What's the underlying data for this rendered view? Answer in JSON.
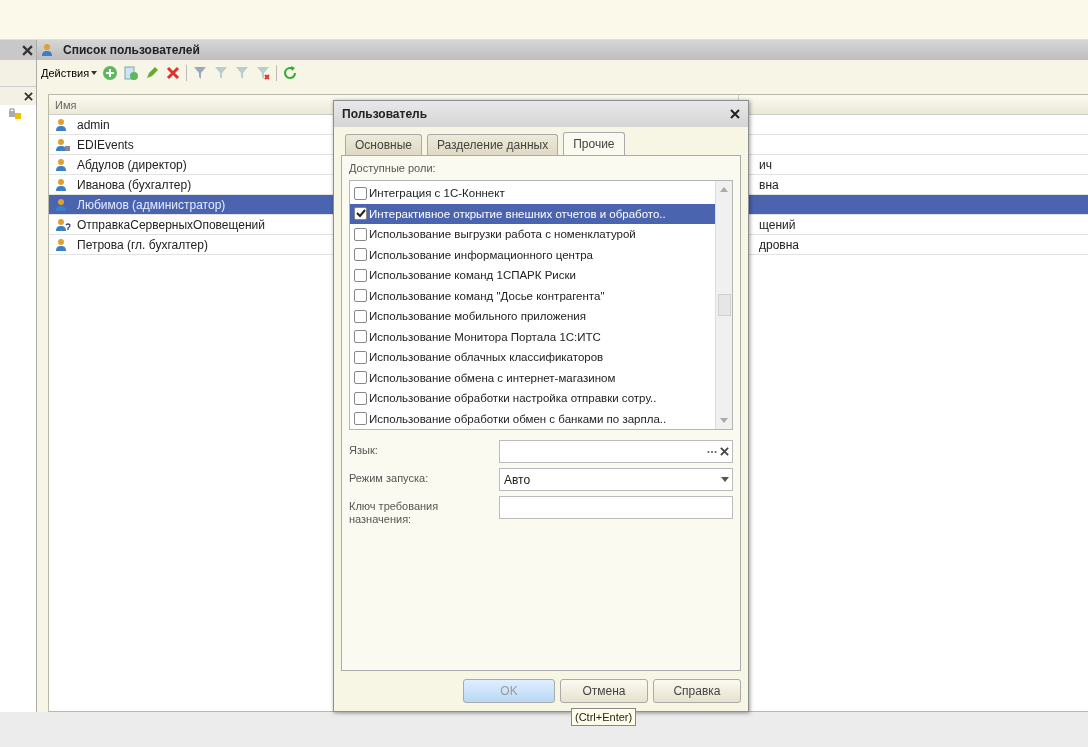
{
  "window": {
    "title": "Список пользователей"
  },
  "toolbar": {
    "actions_menu": "Действия"
  },
  "table": {
    "columns": [
      "Имя"
    ],
    "rows": [
      {
        "name": "admin",
        "kind": "user",
        "selected": false
      },
      {
        "name": "EDIEvents",
        "kind": "locked",
        "selected": false
      },
      {
        "name": "Абдулов (директор)",
        "kind": "user",
        "selected": false,
        "column_2": "ич"
      },
      {
        "name": "Иванова (бухгалтер)",
        "kind": "user",
        "selected": false,
        "column_2": "вна"
      },
      {
        "name": "Любимов (администратор)",
        "kind": "user",
        "selected": true
      },
      {
        "name": "ОтправкаСерверныхОповещений",
        "kind": "unknown",
        "selected": false,
        "column_2": "щений"
      },
      {
        "name": "Петрова (гл. бухгалтер)",
        "kind": "user",
        "selected": false,
        "column_2": "дровна"
      }
    ]
  },
  "dialog": {
    "title": "Пользователь",
    "tabs": [
      {
        "label": "Основные",
        "selected": false
      },
      {
        "label": "Разделение данных",
        "selected": false
      },
      {
        "label": "Прочие",
        "selected": true
      }
    ],
    "roles_label": "Доступные роли:",
    "roles": [
      {
        "label": "Интеграция с 1С-Коннект",
        "checked": false,
        "selected": false
      },
      {
        "label": "Интерактивное открытие внешних отчетов и обработо..",
        "checked": true,
        "selected": true
      },
      {
        "label": "Использование выгрузки работа с номенклатурой",
        "checked": false,
        "selected": false
      },
      {
        "label": "Использование информационного центра",
        "checked": false,
        "selected": false
      },
      {
        "label": "Использование команд 1СПАРК Риски",
        "checked": false,
        "selected": false
      },
      {
        "label": "Использование команд \"Досье контрагента\"",
        "checked": false,
        "selected": false
      },
      {
        "label": "Использование мобильного приложения",
        "checked": false,
        "selected": false
      },
      {
        "label": "Использование Монитора Портала 1С:ИТС",
        "checked": false,
        "selected": false
      },
      {
        "label": "Использование облачных классификаторов",
        "checked": false,
        "selected": false
      },
      {
        "label": "Использование обмена с интернет-магазином",
        "checked": false,
        "selected": false
      },
      {
        "label": "Использование обработки настройка отправки сотру..",
        "checked": false,
        "selected": false
      },
      {
        "label": "Использование обработки обмен с банками по зарпла..",
        "checked": false,
        "selected": false
      }
    ],
    "fields": [
      {
        "label": "Язык:",
        "kind": "choice"
      },
      {
        "label": "Режим запуска:",
        "kind": "select",
        "value": "Авто"
      },
      {
        "label": "Ключ требования назначения:",
        "kind": "text"
      }
    ],
    "buttons": [
      {
        "label": "OK",
        "default": true
      },
      {
        "label": "Отмена",
        "default": false
      },
      {
        "label": "Справка",
        "default": false
      }
    ],
    "tooltip": "(Ctrl+Enter)"
  }
}
